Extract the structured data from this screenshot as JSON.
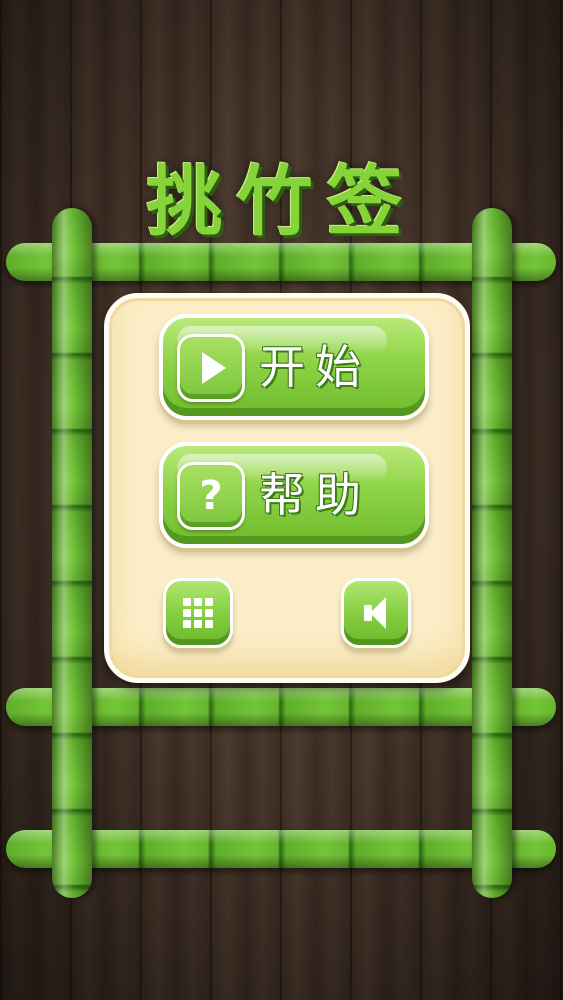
{
  "title": "挑竹签",
  "menu": {
    "start_label": "开始",
    "help_label": "帮助",
    "help_icon_glyph": "?",
    "levels_icon": "grid-icon",
    "sound_icon": "speaker-icon"
  },
  "colors": {
    "accent_green": "#86d43a",
    "panel_cream": "#fbeec7",
    "wood_dark": "#3e2f25"
  }
}
